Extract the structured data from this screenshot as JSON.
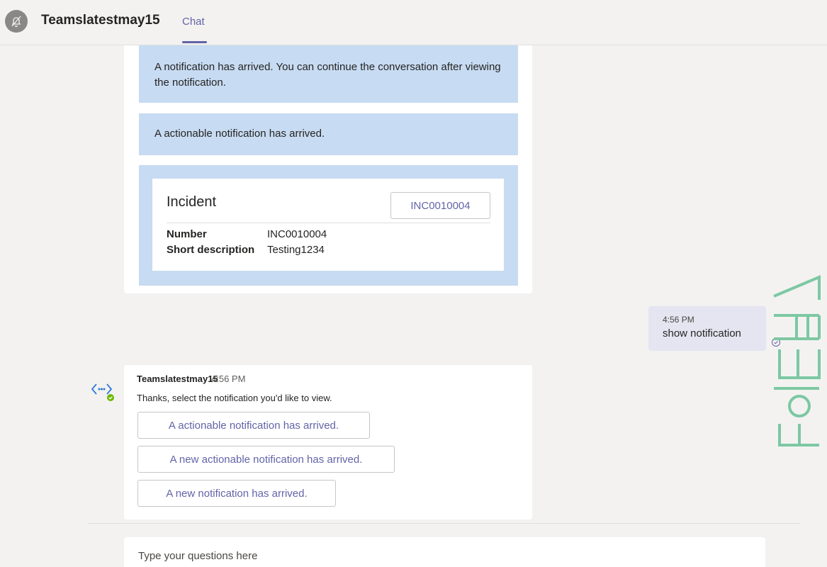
{
  "header": {
    "title": "Teamslatestmay15",
    "tab": "Chat"
  },
  "notifications": [
    "A notification has arrived. You can continue the conversation after viewing the notification.",
    "A actionable notification has arrived."
  ],
  "incident": {
    "title": "Incident",
    "button_label": "INC0010004",
    "facts": [
      {
        "key": "Number",
        "value": "INC0010004"
      },
      {
        "key": "Short description",
        "value": "Testing1234"
      }
    ]
  },
  "user_message": {
    "time": "4:56 PM",
    "text": "show notification"
  },
  "bot_message": {
    "sender": "Teamslatestmay15",
    "time": "4:56 PM",
    "text": "Thanks, select the notification you'd like to view.",
    "choices": [
      "A actionable notification has arrived.",
      "A new actionable notification has arrived.",
      "A new notification has arrived."
    ]
  },
  "composer": {
    "placeholder": "Type your questions here"
  },
  "colors": {
    "accent": "#6264a7",
    "card_blue": "#c7dbf2",
    "user_bubble": "#e5e5f1",
    "watermark_green": "#7cc8a3"
  },
  "icons": {
    "avatar": "bell-off-icon",
    "bot": "bot-code-icon",
    "sent": "check-circle-icon"
  }
}
